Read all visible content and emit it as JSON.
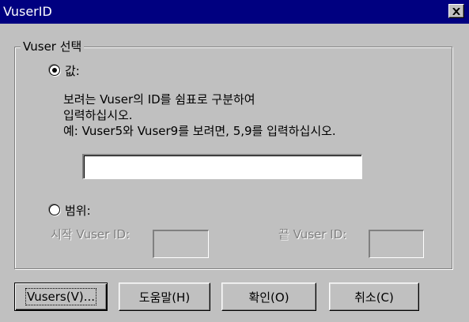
{
  "window": {
    "title": "VuserID",
    "close_glyph": "✕"
  },
  "group": {
    "legend": "Vuser 선택"
  },
  "value_option": {
    "label": "값:",
    "checked": true,
    "instructions": [
      "보려는 Vuser의 ID를 쉼표로 구분하여",
      "입력하십시오.",
      "예: Vuser5와 Vuser9를 보려면, 5,9를 입력하십시오."
    ],
    "input_value": ""
  },
  "range_option": {
    "label": "범위:",
    "checked": false,
    "start_label": "시작 Vuser ID:",
    "end_label": "끝 Vuser ID:"
  },
  "buttons": {
    "vusers": "Vusers(V)...",
    "help": "도움말(H)",
    "ok": "확인(O)",
    "cancel": "취소(C)"
  }
}
